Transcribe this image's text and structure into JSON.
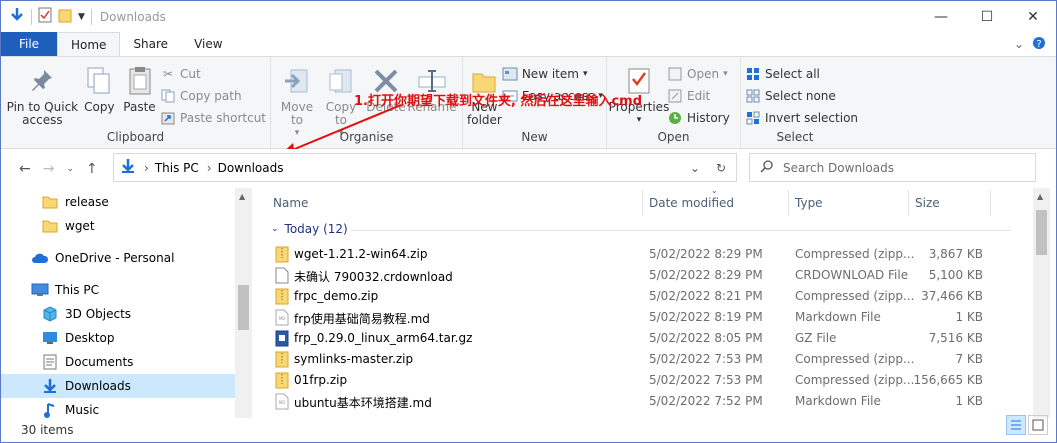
{
  "window": {
    "title": "Downloads"
  },
  "tabs": {
    "file": "File",
    "home": "Home",
    "share": "Share",
    "view": "View"
  },
  "ribbon": {
    "clipboard": {
      "label": "Clipboard",
      "pin": "Pin to Quick access",
      "copy": "Copy",
      "paste": "Paste",
      "cut": "Cut",
      "copy_path": "Copy path",
      "paste_shortcut": "Paste shortcut"
    },
    "organise": {
      "label": "Organise",
      "move_to": "Move to",
      "copy_to": "Copy to",
      "delete": "Delete",
      "rename": "Rename"
    },
    "new": {
      "label": "New",
      "new_folder": "New folder",
      "new_item": "New item",
      "easy_access": "Easy access"
    },
    "open": {
      "label": "Open",
      "properties": "Properties",
      "open": "Open",
      "edit": "Edit",
      "history": "History"
    },
    "select": {
      "label": "Select",
      "select_all": "Select all",
      "select_none": "Select none",
      "invert": "Invert selection"
    }
  },
  "annotation": "1.打开你期望下载到文件夹, 然后在这里输入cmd",
  "address": {
    "root": "This PC",
    "folder": "Downloads"
  },
  "search": {
    "placeholder": "Search Downloads"
  },
  "nav": {
    "items": [
      {
        "label": "release"
      },
      {
        "label": "wget"
      },
      {
        "label": "OneDrive - Personal"
      },
      {
        "label": "This PC"
      },
      {
        "label": "3D Objects"
      },
      {
        "label": "Desktop"
      },
      {
        "label": "Documents"
      },
      {
        "label": "Downloads"
      },
      {
        "label": "Music"
      }
    ]
  },
  "columns": {
    "name": "Name",
    "date": "Date modified",
    "type": "Type",
    "size": "Size"
  },
  "group": {
    "label": "Today (12)"
  },
  "files": [
    {
      "name": "wget-1.21.2-win64.zip",
      "date": "5/02/2022 8:29 PM",
      "type": "Compressed (zipp...",
      "size": "3,867 KB",
      "icon": "zip-icon"
    },
    {
      "name": "未确认 790032.crdownload",
      "date": "5/02/2022 8:29 PM",
      "type": "CRDOWNLOAD File",
      "size": "5,100 KB",
      "icon": "file-icon"
    },
    {
      "name": "frpc_demo.zip",
      "date": "5/02/2022 8:21 PM",
      "type": "Compressed (zipp...",
      "size": "37,466 KB",
      "icon": "zip-icon"
    },
    {
      "name": "frp使用基础简易教程.md",
      "date": "5/02/2022 8:19 PM",
      "type": "Markdown File",
      "size": "1 KB",
      "icon": "md-icon"
    },
    {
      "name": "frp_0.29.0_linux_arm64.tar.gz",
      "date": "5/02/2022 8:05 PM",
      "type": "GZ File",
      "size": "7,516 KB",
      "icon": "gz-icon"
    },
    {
      "name": "symlinks-master.zip",
      "date": "5/02/2022 7:53 PM",
      "type": "Compressed (zipp...",
      "size": "7 KB",
      "icon": "zip-icon"
    },
    {
      "name": "01frp.zip",
      "date": "5/02/2022 7:53 PM",
      "type": "Compressed (zipp...",
      "size": "156,665 KB",
      "icon": "zip-icon"
    },
    {
      "name": "ubuntu基本环境搭建.md",
      "date": "5/02/2022 7:52 PM",
      "type": "Markdown File",
      "size": "1 KB",
      "icon": "md-icon"
    }
  ],
  "status": {
    "count": "30 items"
  },
  "colors": {
    "accent": "#1e5fbb",
    "annotation": "#e01010",
    "selected": "#cce8ff"
  }
}
